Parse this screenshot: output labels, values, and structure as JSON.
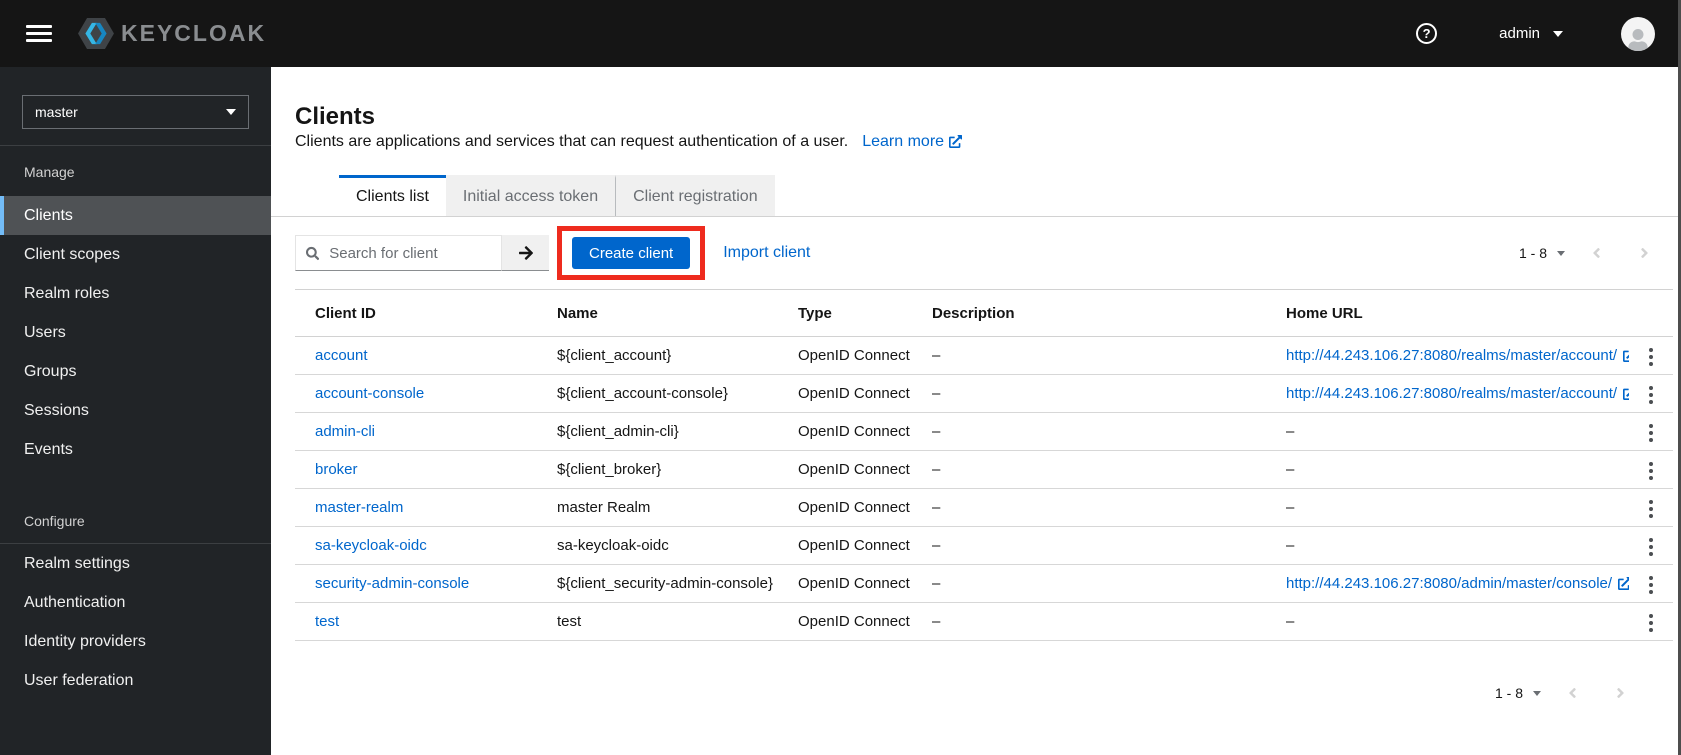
{
  "topbar": {
    "brand": "KEYCLOAK",
    "help_icon_glyph": "?",
    "username": "admin"
  },
  "sidebar": {
    "realm_selector": {
      "value": "master"
    },
    "groups": [
      {
        "label": "Manage",
        "items": [
          {
            "label": "Clients",
            "selected": true
          },
          {
            "label": "Client scopes"
          },
          {
            "label": "Realm roles"
          },
          {
            "label": "Users"
          },
          {
            "label": "Groups"
          },
          {
            "label": "Sessions"
          },
          {
            "label": "Events"
          }
        ]
      },
      {
        "label": "Configure",
        "items": [
          {
            "label": "Realm settings"
          },
          {
            "label": "Authentication"
          },
          {
            "label": "Identity providers"
          },
          {
            "label": "User federation"
          }
        ]
      }
    ]
  },
  "page": {
    "title": "Clients",
    "subtitle": "Clients are applications and services that can request authentication of a user.",
    "learn_more_label": "Learn more",
    "tabs": [
      {
        "label": "Clients list",
        "active": true
      },
      {
        "label": "Initial access token",
        "active": false
      },
      {
        "label": "Client registration",
        "active": false
      }
    ],
    "toolbar": {
      "search_placeholder": "Search for client",
      "create_button_label": "Create client",
      "import_link_label": "Import client"
    },
    "pagination": {
      "range": "1 - 8"
    },
    "table": {
      "columns": [
        "Client ID",
        "Name",
        "Type",
        "Description",
        "Home URL"
      ],
      "empty_cell": "–",
      "rows": [
        {
          "client_id": "account",
          "name": "${client_account}",
          "type": "OpenID Connect",
          "description": "–",
          "home_url": "http://44.243.106.27:8080/realms/master/account/"
        },
        {
          "client_id": "account-console",
          "name": "${client_account-console}",
          "type": "OpenID Connect",
          "description": "–",
          "home_url": "http://44.243.106.27:8080/realms/master/account/"
        },
        {
          "client_id": "admin-cli",
          "name": "${client_admin-cli}",
          "type": "OpenID Connect",
          "description": "–",
          "home_url": ""
        },
        {
          "client_id": "broker",
          "name": "${client_broker}",
          "type": "OpenID Connect",
          "description": "–",
          "home_url": ""
        },
        {
          "client_id": "master-realm",
          "name": "master Realm",
          "type": "OpenID Connect",
          "description": "–",
          "home_url": ""
        },
        {
          "client_id": "sa-keycloak-oidc",
          "name": "sa-keycloak-oidc",
          "type": "OpenID Connect",
          "description": "–",
          "home_url": ""
        },
        {
          "client_id": "security-admin-console",
          "name": "${client_security-admin-console}",
          "type": "OpenID Connect",
          "description": "–",
          "home_url": "http://44.243.106.27:8080/admin/master/console/"
        },
        {
          "client_id": "test",
          "name": "test",
          "type": "OpenID Connect",
          "description": "–",
          "home_url": ""
        }
      ]
    }
  },
  "colors": {
    "accent": "#0066cc",
    "annotation_red": "#ee2b1e",
    "nav_selected_bg": "#4f5255",
    "nav_selected_border": "#73bcf7",
    "topbar_bg": "#151515",
    "sidebar_bg": "#212427"
  }
}
